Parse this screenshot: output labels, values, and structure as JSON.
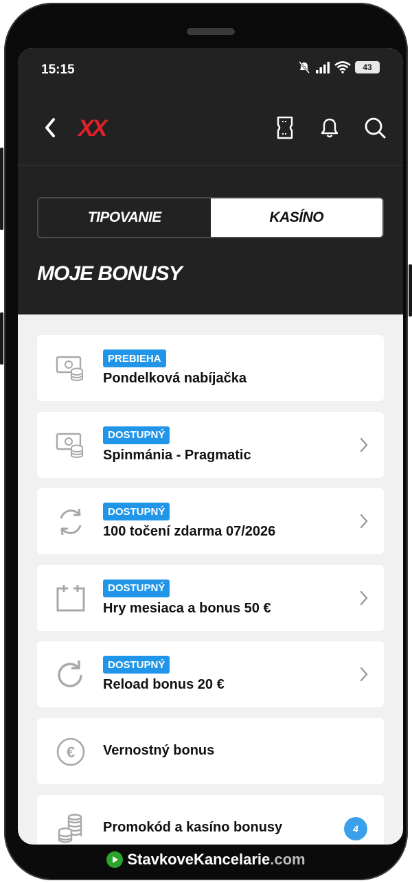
{
  "status": {
    "time": "15:15",
    "battery": "43"
  },
  "appbar": {
    "logo": "XX",
    "icons": [
      "back-icon",
      "ticket-icon",
      "bell-icon",
      "search-icon"
    ]
  },
  "tabs": [
    {
      "label": "TIPOVANIE",
      "active": false
    },
    {
      "label": "KASÍNO",
      "active": true
    }
  ],
  "page_title": "MOJE BONUSY",
  "bonuses": [
    {
      "status": "PREBIEHA",
      "title": "Pondelková nabíjačka",
      "icon": "money-coins-icon",
      "chevron": false
    },
    {
      "status": "DOSTUPNÝ",
      "title": "Spinmánia - Pragmatic",
      "icon": "money-coins-icon",
      "chevron": true
    },
    {
      "status": "DOSTUPNÝ",
      "title": "100 točení zdarma 07/2026",
      "icon": "refresh-cycle-icon",
      "chevron": true
    },
    {
      "status": "DOSTUPNÝ",
      "title": "Hry mesiaca a bonus 50 €",
      "icon": "calendar-icon",
      "chevron": true
    },
    {
      "status": "DOSTUPNÝ",
      "title": "Reload bonus 20 €",
      "icon": "reload-icon",
      "chevron": true
    },
    {
      "status": "",
      "title": "Vernostný bonus",
      "icon": "euro-circle-icon",
      "chevron": false
    },
    {
      "status": "",
      "title": "Promokód a kasíno bonusy",
      "icon": "coin-stack-icon",
      "chevron": false,
      "count": "4"
    }
  ],
  "footer": {
    "brand": "StavkoveKancelarie",
    "tld": ".com"
  },
  "colors": {
    "accent": "#2196e8",
    "logo": "#e3202a",
    "header": "#222222"
  }
}
